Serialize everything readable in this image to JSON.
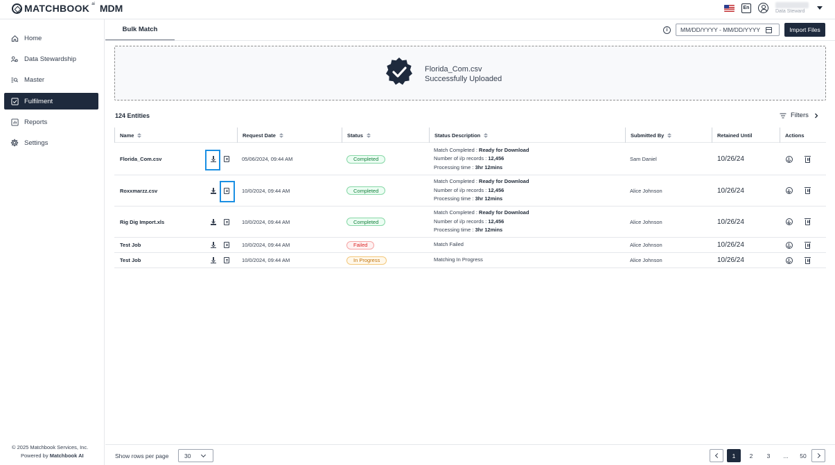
{
  "header": {
    "logo_text": "MATCHBOOK",
    "logo_superscript": "ai",
    "product": "MDM",
    "language": "En",
    "user_role": "Data Steward"
  },
  "sidebar": {
    "items": [
      {
        "label": "Home",
        "icon": "home-icon"
      },
      {
        "label": "Data Stewardship",
        "icon": "people-icon"
      },
      {
        "label": "Master",
        "icon": "list-search-icon"
      },
      {
        "label": "Fulfilment",
        "icon": "checkbox-icon"
      },
      {
        "label": "Reports",
        "icon": "report-icon"
      },
      {
        "label": "Settings",
        "icon": "gear-icon"
      }
    ],
    "active": "Fulfilment",
    "footer_copyright": "© 2025 Matchbook Services, Inc.",
    "footer_powered_prefix": "Powered by",
    "footer_powered_brand": "Matchbook AI"
  },
  "main": {
    "tab": "Bulk Match",
    "date_range_placeholder": "MM/DD/YYYY - MM/DD/YYYY",
    "import_button": "Import Files",
    "upload": {
      "filename": "Florida_Com.csv",
      "message": "Successfully Uploaded"
    },
    "entities_count": "124 Entities",
    "filters_label": "Filters"
  },
  "table": {
    "columns": [
      "Name",
      "Request Date",
      "Status",
      "Status Description",
      "Submitted By",
      "Retained Until",
      "Actions"
    ],
    "rows": [
      {
        "name": "Florida_Com.csv",
        "date": "05/06/2024, 09:44 AM",
        "status": "Completed",
        "status_type": "ok",
        "desc1_prefix": "Match Completed : ",
        "desc1_bold": "Ready for Download",
        "desc2_prefix": "Number of i/p records : ",
        "desc2_bold": "12,456",
        "desc3_prefix": "Processing time : ",
        "desc3_bold": "3hr 12mins",
        "submitted_by": "Sam Daniel",
        "retained": "10/26/24"
      },
      {
        "name": "Roxxmarzz.csv",
        "date": "10/0/2024, 09:44 AM",
        "status": "Completed",
        "status_type": "ok",
        "desc1_prefix": "Match Completed : ",
        "desc1_bold": "Ready for Download",
        "desc2_prefix": "Number of i/p records : ",
        "desc2_bold": "12,456",
        "desc3_prefix": "Processing time : ",
        "desc3_bold": "3hr 12mins",
        "submitted_by": "Alice Johnson",
        "retained": "10/26/24"
      },
      {
        "name": "Rig Dig Import.xls",
        "date": "10/0/2024, 09:44 AM",
        "status": "Completed",
        "status_type": "ok",
        "desc1_prefix": "Match Completed : ",
        "desc1_bold": "Ready for Download",
        "desc2_prefix": "Number of i/p records : ",
        "desc2_bold": "12,456",
        "desc3_prefix": "Processing time : ",
        "desc3_bold": "3hr 12mins",
        "submitted_by": "Alice Johnson",
        "retained": "10/26/24"
      },
      {
        "name": "Test Job",
        "date": "10/0/2024, 09:44 AM",
        "status": "Failed",
        "status_type": "fail",
        "desc_single": "Match Failed",
        "submitted_by": "Alice Johnson",
        "retained": "10/26/24"
      },
      {
        "name": "Test Job",
        "date": "10/0/2024, 09:44 AM",
        "status": "In Progress",
        "status_type": "prog",
        "desc_single": "Matching In Progress",
        "submitted_by": "Alice Johnson",
        "retained": "10/26/24"
      }
    ]
  },
  "pagination": {
    "rows_label": "Show rows per page",
    "rows_value": "30",
    "pages": [
      "1",
      "2",
      "3",
      "...",
      "50"
    ],
    "current": "1"
  },
  "colors": {
    "navy": "#1e2a3d",
    "highlight": "#1a8fe3",
    "completed": "#15803d",
    "failed": "#dc2626",
    "in_progress": "#c2740b"
  }
}
